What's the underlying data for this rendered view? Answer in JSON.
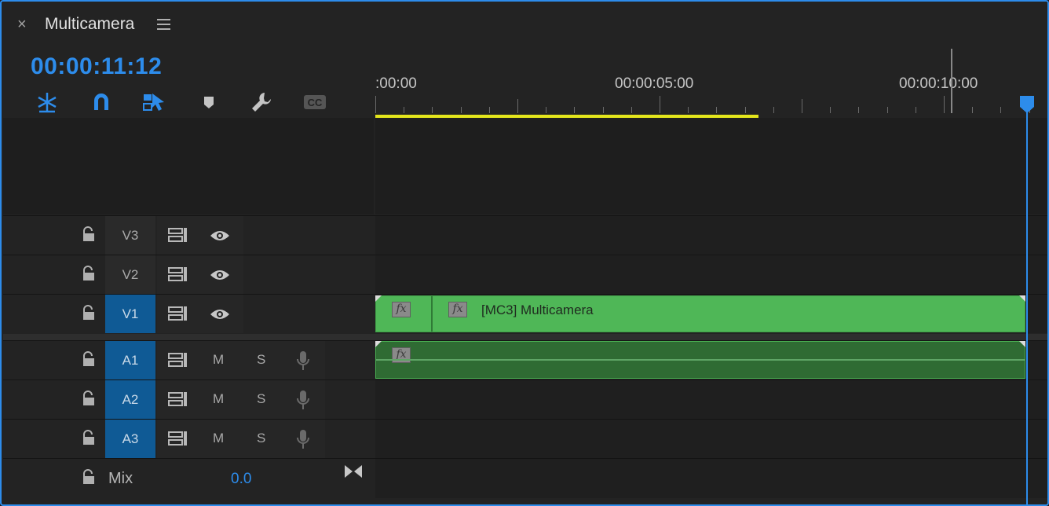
{
  "panel": {
    "close_label": "×",
    "title": "Multicamera",
    "timecode": "00:00:11:12"
  },
  "toolbar": {
    "tools": [
      "insert-nest-icon",
      "snap-magnet-icon",
      "linked-selection-icon",
      "add-marker-icon",
      "settings-wrench-icon",
      "captions-icon"
    ],
    "captions_label": "CC"
  },
  "ruler": {
    "labels": [
      ":00:00",
      "00:00:05:00",
      "00:00:10:00"
    ]
  },
  "tracks": {
    "video": [
      {
        "label": "V3",
        "targeted": false
      },
      {
        "label": "V2",
        "targeted": false
      },
      {
        "label": "V1",
        "targeted": true
      }
    ],
    "audio": [
      {
        "label": "A1",
        "mute": "M",
        "solo": "S",
        "targeted": true
      },
      {
        "label": "A2",
        "mute": "M",
        "solo": "S",
        "targeted": true
      },
      {
        "label": "A3",
        "mute": "M",
        "solo": "S",
        "targeted": true
      }
    ],
    "mix": {
      "label": "Mix",
      "value": "0.0"
    }
  },
  "clips": {
    "video_clip_name": "[MC3] Multicamera",
    "fx_label": "fx"
  },
  "colors": {
    "accent": "#2d8ceb",
    "clip_video": "#4fb757",
    "clip_audio": "#2f6b33",
    "work_area": "#e3e51c",
    "track_target": "#0f5a95"
  }
}
